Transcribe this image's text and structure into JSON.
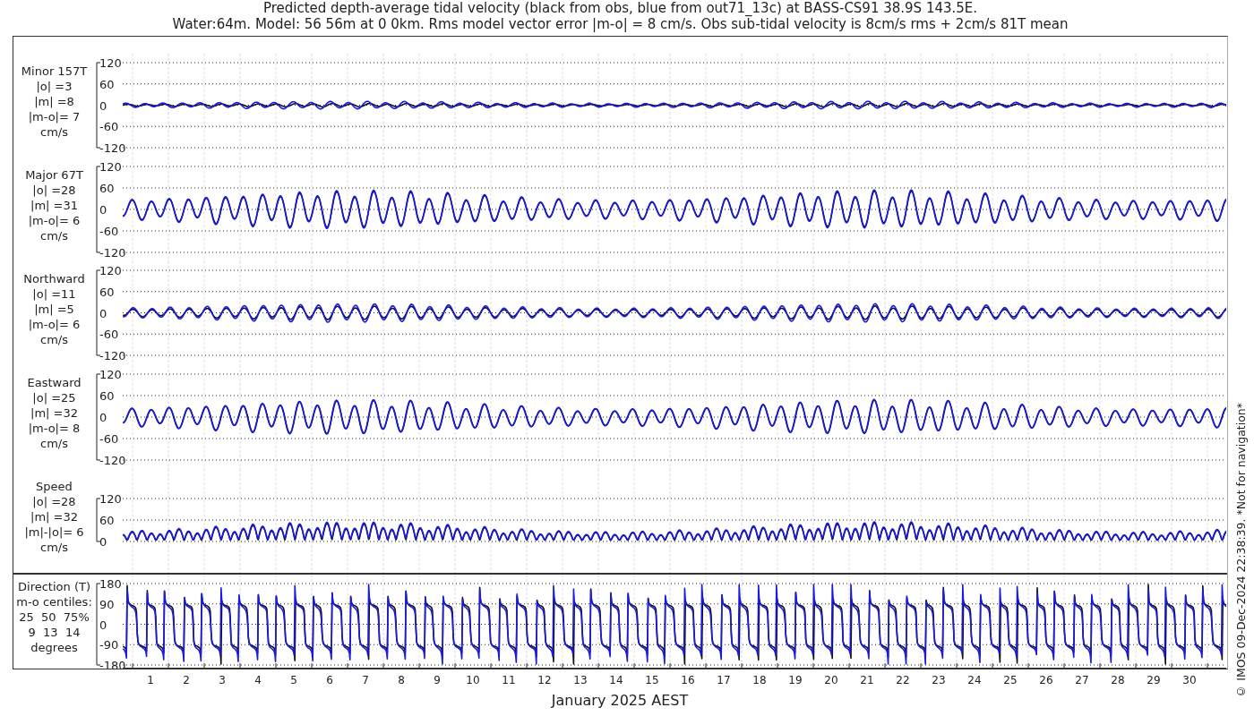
{
  "title_lines": [
    "Predicted depth-average tidal velocity (black from obs, blue from out71_13c) at BASS-CS91 38.9S 143.5E.",
    "Water:64m. Model: 56 56m at 0 0km. Rms model vector error |m-o| = 8 cm/s. Obs sub-tidal velocity is 8cm/s rms + 2cm/s 81T mean"
  ],
  "panels": [
    {
      "kind": "minor",
      "label_lines": [
        "Minor 157T",
        "|o| =3",
        "|m| =8",
        "|m-o|= 7",
        "cm/s"
      ],
      "yticks": [
        "120",
        "60",
        "0",
        "-60",
        "-120"
      ]
    },
    {
      "kind": "major",
      "label_lines": [
        "Major 67T",
        "|o| =28",
        "|m| =31",
        "|m-o|= 6",
        "cm/s"
      ],
      "yticks": [
        "120",
        "60",
        "0",
        "-60",
        "-120"
      ]
    },
    {
      "kind": "north",
      "label_lines": [
        "Northward",
        "|o| =11",
        "|m| =5",
        "|m-o|= 6",
        "cm/s"
      ],
      "yticks": [
        "120",
        "60",
        "0",
        "-60",
        "-120"
      ]
    },
    {
      "kind": "east",
      "label_lines": [
        "Eastward",
        "|o| =25",
        "|m| =32",
        "|m-o|= 8",
        "cm/s"
      ],
      "yticks": [
        "120",
        "60",
        "0",
        "-60",
        "-120"
      ]
    },
    {
      "kind": "speed",
      "label_lines": [
        "Speed",
        "|o| =28",
        "|m| =32",
        "|m|-|o|= 6",
        "cm/s"
      ],
      "yticks": [
        "120",
        "60",
        "0"
      ]
    },
    {
      "kind": "direction",
      "label_lines": [
        "Direction (T)",
        "m-o centiles:",
        "25  50  75%",
        "9  13  14",
        "degrees"
      ],
      "yticks": [
        "180",
        "90",
        "0",
        "-90",
        "-180"
      ]
    }
  ],
  "x_ticks": [
    "1",
    "2",
    "3",
    "4",
    "5",
    "6",
    "7",
    "8",
    "9",
    "10",
    "11",
    "12",
    "13",
    "14",
    "15",
    "16",
    "17",
    "18",
    "19",
    "20",
    "21",
    "22",
    "23",
    "24",
    "25",
    "26",
    "27",
    "28",
    "29",
    "30"
  ],
  "x_label": "January 2025 AEST",
  "credit": "© IMOS 09-Dec-2024 22:38:39. *Not for navigation*"
}
